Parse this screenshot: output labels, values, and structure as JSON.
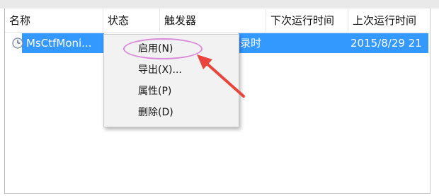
{
  "columns": [
    {
      "label": "名称"
    },
    {
      "label": "状态"
    },
    {
      "label": "触发器"
    },
    {
      "label": "下次运行时间"
    },
    {
      "label": "上次运行时间"
    }
  ],
  "row": {
    "name": "MsCtfMoni...",
    "trigger_partial": "录时",
    "last_run": "2015/8/29 21"
  },
  "context_menu": {
    "items": [
      {
        "label": "启用(N)"
      },
      {
        "label": "导出(X)..."
      },
      {
        "label": "属性(P)"
      },
      {
        "label": "删除(D)"
      }
    ]
  },
  "colors": {
    "selection": "#3399ff",
    "highlight_oval": "#d98ad9",
    "arrow": "#e8453c"
  },
  "icons": {
    "task": "clock-icon"
  }
}
